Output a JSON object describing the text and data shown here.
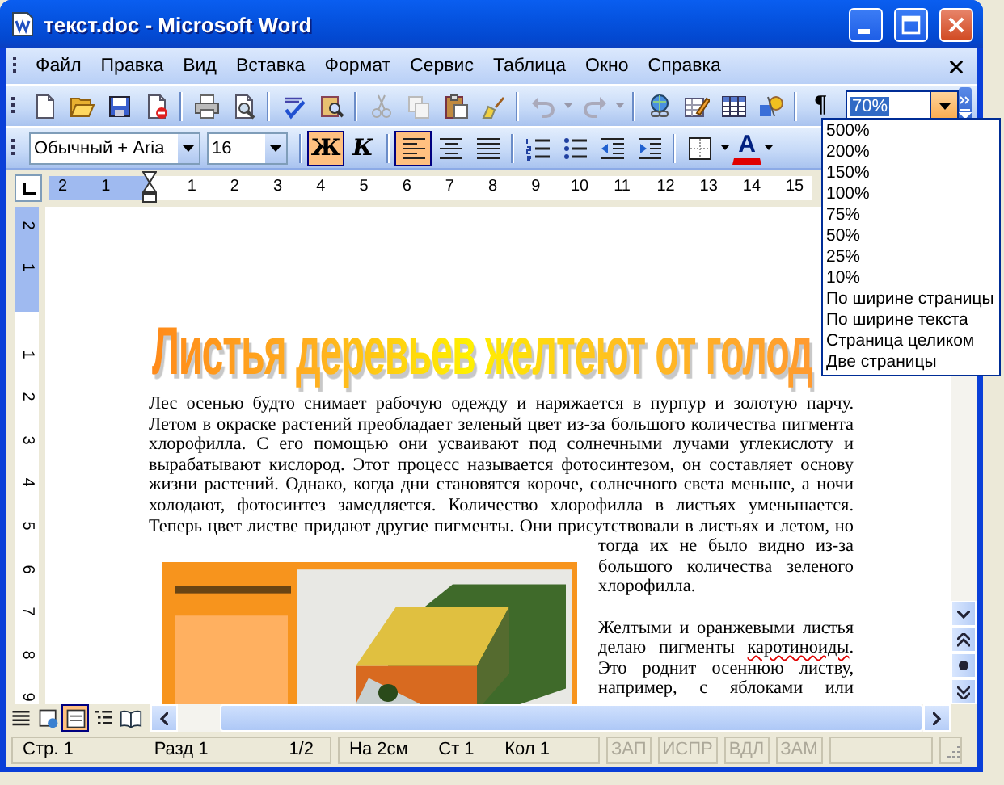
{
  "window": {
    "title": "текст.doc - Microsoft Word"
  },
  "menu": [
    "Файл",
    "Правка",
    "Вид",
    "Вставка",
    "Формат",
    "Сервис",
    "Таблица",
    "Окно",
    "Справка"
  ],
  "standard_toolbar": {
    "pilcrow": "¶",
    "zoom": "70%"
  },
  "zoom_dropdown": {
    "options": [
      "500%",
      "200%",
      "150%",
      "100%",
      "75%",
      "50%",
      "25%",
      "10%",
      "По ширине страницы",
      "По ширине текста",
      "Страница целиком",
      "Две страницы"
    ]
  },
  "formatting_toolbar": {
    "style": "Обычный + Aria",
    "size": "16",
    "bold": {
      "label": "Ж",
      "selected": true
    },
    "italic": {
      "label": "К",
      "selected": false
    },
    "alignment": [
      {
        "selected": true
      },
      {
        "selected": false
      },
      {
        "selected": false
      }
    ],
    "font_color": "A"
  },
  "ruler": {
    "horizontal": [
      "2",
      "1",
      "1",
      "2",
      "3",
      "4",
      "5",
      "6",
      "7",
      "8",
      "9",
      "10",
      "11",
      "12",
      "13",
      "14",
      "15"
    ],
    "vertical": [
      "2",
      "1",
      "1",
      "2",
      "3",
      "4",
      "5",
      "6",
      "7",
      "8",
      "9"
    ]
  },
  "document": {
    "heading": "Листья деревьев желтеют от голод",
    "body_lines": [
      "Лес осенью будто снимает рабочую одежду и наряжается в пурпур и золотую парчу.",
      "Летом в окраске растений преобладает зеленый цвет из-за большого количества пигмента",
      "хлорофилла. С его помощью они усваивают под солнечными лучами углекислоту и",
      "вырабатывают кислород. Этот процесс называется фотосинтезом, он составляет основу",
      "жизни растений. Однако, когда дни становятся короче, солнечного света меньше, а ночи",
      "холодают, фотосинтез замедляется. Количество хлорофилла в листьях уменьшается.",
      "Теперь цвет листве придают другие пигменты. Они присутствовали в листьях и летом, но"
    ],
    "side_paragraphs": [
      {
        "lines": [
          [
            {
              "text": "тогда их не было видно из-за"
            }
          ],
          [
            {
              "text": "большого количества зеленого"
            }
          ],
          [
            {
              "text": "хлорофилла."
            }
          ]
        ]
      },
      {
        "lines": [
          [
            {
              "text": "Желтыми и оранжевыми листья"
            }
          ],
          [
            {
              "text": "делаю пигменты "
            },
            {
              "text": "каротиноиды",
              "misspelled": true
            },
            {
              "text": "."
            }
          ],
          [
            {
              "text": "Это роднит осеннюю листву,"
            }
          ],
          [
            {
              "text": "например, с яблоками или"
            }
          ]
        ]
      }
    ]
  },
  "view_buttons": [
    {
      "selected": false
    },
    {
      "selected": false
    },
    {
      "selected": true
    },
    {
      "selected": false
    },
    {
      "selected": false
    }
  ],
  "status_bar": {
    "groups": [
      [
        "Стр. 1",
        "Разд 1",
        "1/2"
      ],
      [
        "На 2см",
        "Ст 1",
        "Кол 1"
      ]
    ],
    "modes": [
      {
        "label": "ЗАП",
        "enabled": false
      },
      {
        "label": "ИСПР",
        "enabled": false
      },
      {
        "label": "ВДЛ",
        "enabled": false
      },
      {
        "label": "ЗАМ",
        "enabled": false
      }
    ]
  }
}
